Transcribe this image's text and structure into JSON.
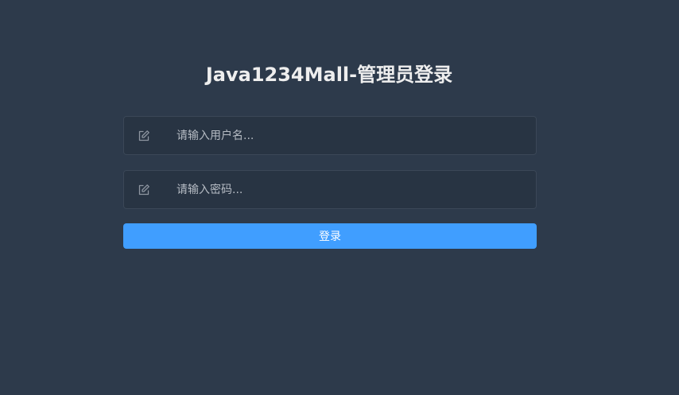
{
  "login": {
    "title": "Java1234Mall-管理员登录",
    "username": {
      "icon": "edit-icon",
      "placeholder": "请输入用户名...",
      "value": ""
    },
    "password": {
      "icon": "edit-icon",
      "placeholder": "请输入密码...",
      "value": ""
    },
    "submit_label": "登录"
  },
  "colors": {
    "background": "#2d3a4b",
    "input_background": "#283443",
    "button": "#409eff",
    "title": "#eeeeee"
  }
}
